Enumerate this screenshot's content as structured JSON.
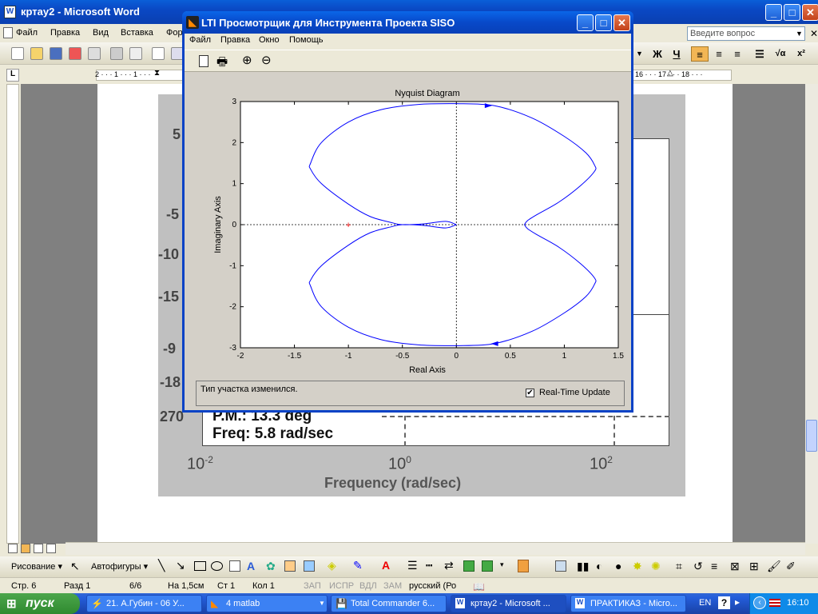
{
  "word": {
    "title": "кртау2 - Microsoft Word",
    "menu": [
      "Файл",
      "Правка",
      "Вид",
      "Вставка",
      "Фор"
    ],
    "ask_placeholder": "Введите вопрос",
    "format_buttons": [
      "Ж",
      "Ч"
    ],
    "ruler_left": "2 · · · 1 · · · 1 · · ·",
    "ruler_right": "16 · · · 17 · · · 18 · · ·",
    "drawing_label": "Рисование",
    "autoshapes_label": "Автофигуры",
    "status": {
      "page": "Стр. 6",
      "section": "Разд 1",
      "pages": "6/6",
      "at": "На 1,5см",
      "line": "Ст 1",
      "col": "Кол 1",
      "rec": "ЗАП",
      "trk": "ИСПР",
      "ext": "ВДЛ",
      "ovr": "ЗАМ",
      "lang": "русский (Ро"
    }
  },
  "background_plot": {
    "left_labels": [
      "5",
      "-5",
      "-10",
      "-15",
      "-9",
      "-18",
      "270"
    ],
    "pm_text": "P.M.: 13.3 deg",
    "freq_text": "Freq: 5.8 rad/sec",
    "x_ticks": [
      {
        "base": "10",
        "exp": "-2"
      },
      {
        "base": "10",
        "exp": "0"
      },
      {
        "base": "10",
        "exp": "2"
      }
    ],
    "xlabel": "Frequency (rad/sec)"
  },
  "lti": {
    "title": "LTI Просмотрщик для Инструмента Проекта SISO",
    "menu": [
      "Файл",
      "Правка",
      "Окно",
      "Помощь"
    ],
    "status_text": "Тип участка изменился.",
    "realtime_label": "Real-Time Update",
    "realtime_checked": true
  },
  "chart_data": {
    "type": "line",
    "title": "Nyquist Diagram",
    "xlabel": "Real Axis",
    "ylabel": "Imaginary Axis",
    "xlim": [
      -2,
      1.5
    ],
    "ylim": [
      -3,
      3
    ],
    "xticks": [
      -2,
      -1.5,
      -1,
      -0.5,
      0,
      0.5,
      1,
      1.5
    ],
    "yticks": [
      -3,
      -2,
      -1,
      0,
      1,
      2,
      3
    ],
    "grid": false,
    "color": "#0000ff",
    "critical_point": [
      -1,
      0
    ],
    "series": [
      {
        "x": [
          0,
          -0.35,
          -0.7,
          -1.0,
          -1.25,
          -1.35,
          -1.35,
          -1.25,
          -1.0,
          -0.8,
          -0.6,
          -0.5,
          -0.3,
          -0.1,
          0.0
        ],
        "y": [
          2.95,
          2.93,
          2.8,
          2.5,
          2.0,
          1.5,
          1.35,
          1.0,
          0.5,
          0.2,
          0.05,
          0.0,
          0.02,
          0.08,
          0.0
        ]
      },
      {
        "x": [
          0,
          0.35,
          0.7,
          1.0,
          1.2,
          1.28,
          1.28,
          1.15,
          0.95,
          0.75,
          0.66,
          0.63
        ],
        "y": [
          2.95,
          2.9,
          2.6,
          2.15,
          1.75,
          1.45,
          1.3,
          0.95,
          0.55,
          0.25,
          0.1,
          0.0
        ]
      },
      {
        "x": [
          0,
          -0.35,
          -0.7,
          -1.0,
          -1.25,
          -1.35,
          -1.35,
          -1.25,
          -1.0,
          -0.8,
          -0.6,
          -0.5,
          -0.3,
          -0.1,
          0.0
        ],
        "y": [
          -2.95,
          -2.93,
          -2.8,
          -2.5,
          -2.0,
          -1.5,
          -1.35,
          -1.0,
          -0.5,
          -0.2,
          -0.05,
          0.0,
          -0.02,
          -0.08,
          0.0
        ]
      },
      {
        "x": [
          0,
          0.35,
          0.7,
          1.0,
          1.2,
          1.28,
          1.28,
          1.15,
          0.95,
          0.75,
          0.66,
          0.63
        ],
        "y": [
          -2.95,
          -2.9,
          -2.6,
          -2.15,
          -1.75,
          -1.45,
          -1.3,
          -0.95,
          -0.55,
          -0.25,
          -0.1,
          0.0
        ]
      }
    ],
    "arrows": [
      [
        0.3,
        2.9
      ],
      [
        0.35,
        -2.9
      ]
    ]
  },
  "taskbar": {
    "start": "пуск",
    "items": [
      "21. А.Губин - 06 У...",
      "4 matlab",
      "Total Commander 6...",
      "кртау2 - Microsoft ...",
      "ПРАКТИКАЗ - Micro..."
    ],
    "lang": "EN",
    "time": "16:10"
  }
}
